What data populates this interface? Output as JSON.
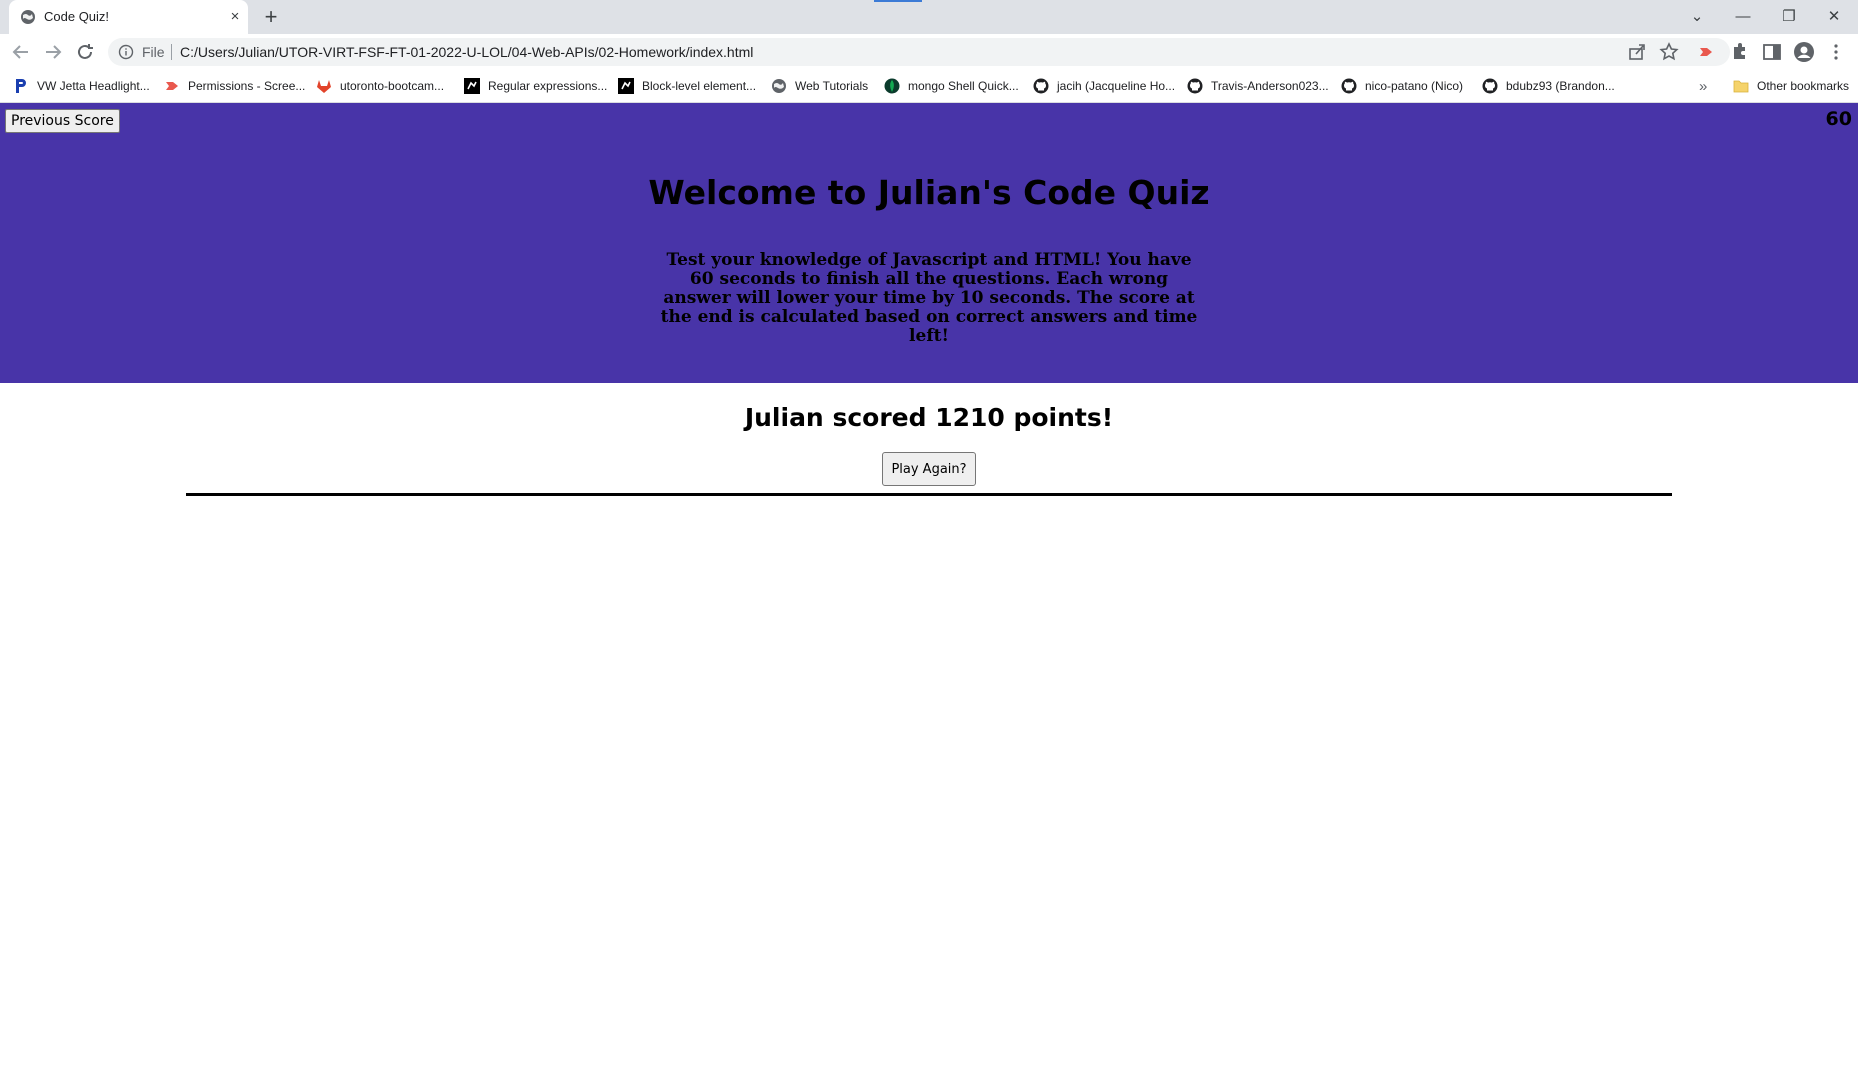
{
  "browser": {
    "tab": {
      "title": "Code Quiz!",
      "close_icon": "×",
      "new_tab_icon": "+"
    },
    "window_controls": {
      "tab_search": "⌄",
      "minimize": "—",
      "restore": "❐",
      "close": "✕"
    },
    "address_bar": {
      "scheme_label": "File",
      "url": "C:/Users/Julian/UTOR-VIRT-FSF-FT-01-2022-U-LOL/04-Web-APIs/02-Homework/index.html"
    },
    "bookmarks": [
      {
        "label": "VW Jetta Headlight...",
        "icon": "p-logo-icon",
        "color": "#1a3fb0"
      },
      {
        "label": "Permissions - Scree...",
        "icon": "permissions-icon",
        "color": "#e9584e"
      },
      {
        "label": "utoronto-bootcam...",
        "icon": "gitlab-icon",
        "color": "#e2432a"
      },
      {
        "label": "Regular expressions...",
        "icon": "mdn-icon",
        "color": "#000000"
      },
      {
        "label": "Block-level element...",
        "icon": "mdn-icon",
        "color": "#000000"
      },
      {
        "label": "Web Tutorials",
        "icon": "globe-icon",
        "color": "#5f6368"
      },
      {
        "label": "mongo Shell Quick...",
        "icon": "mongodb-icon",
        "color": "#13aa52"
      },
      {
        "label": "jacih (Jacqueline Ho...",
        "icon": "github-icon",
        "color": "#202124"
      },
      {
        "label": "Travis-Anderson023...",
        "icon": "github-icon",
        "color": "#202124"
      },
      {
        "label": "nico-patano (Nico)",
        "icon": "github-icon",
        "color": "#202124"
      },
      {
        "label": "bdubz93 (Brandon...",
        "icon": "github-icon",
        "color": "#202124"
      }
    ],
    "bookmarks_overflow": "»",
    "other_bookmarks": "Other bookmarks"
  },
  "page": {
    "previous_score_label": "Previous Score",
    "timer": "60",
    "title": "Welcome to Julian's Code Quiz",
    "description": "Test your knowledge of Javascript and HTML! You have 60 seconds to finish all the questions. Each wrong answer will lower your time by 10 seconds. The score at the end is calculated based on correct answers and time left!",
    "score_text": "Julian scored 1210 points!",
    "play_again_label": "Play Again?"
  },
  "colors": {
    "hero_background": "#4834a8",
    "tabstrip": "#dee1e6",
    "omnibox": "#f1f3f4"
  }
}
